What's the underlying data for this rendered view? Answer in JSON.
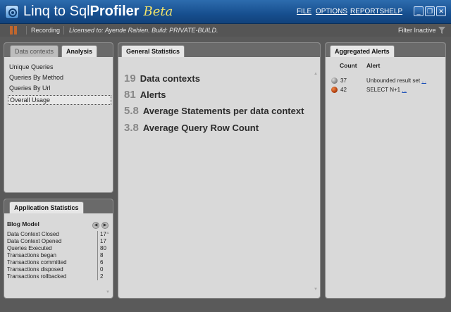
{
  "window": {
    "title_part1": "Linq to Sql",
    "title_part2": "Profiler",
    "title_part3": "Beta",
    "menu": [
      "FILE",
      "OPTIONS",
      "REPORTS",
      "HELP"
    ],
    "controls": [
      "_",
      "❐",
      "✕"
    ]
  },
  "toolbar": {
    "recording_label": "Recording",
    "license_text": "Licensed to: Ayende Rahien.  Build: PRIVATE-BUILD.",
    "filter_label": "Filter Inactive"
  },
  "left_panel": {
    "tabs": [
      "Data contexts",
      "Analysis"
    ],
    "items": [
      "Unique Queries",
      "Queries By Method",
      "Queries By Url",
      "Overall Usage"
    ]
  },
  "general_statistics": {
    "tab": "General Statistics",
    "stats": [
      {
        "value": "19",
        "label": "Data contexts"
      },
      {
        "value": "81",
        "label": "Alerts"
      },
      {
        "value": "5.8",
        "label": "Average Statements per data context"
      },
      {
        "value": "3.8",
        "label": "Average Query Row Count"
      }
    ]
  },
  "aggregated_alerts": {
    "tab": "Aggregated Alerts",
    "col_count": "Count",
    "col_alert": "Alert",
    "rows": [
      {
        "count": "37",
        "alert": "Unbounded result set",
        "link": "...",
        "color": "#8a8a8a"
      },
      {
        "count": "42",
        "alert": "SELECT N+1",
        "link": "...",
        "color": "#b3400f"
      }
    ]
  },
  "application_statistics": {
    "tab": "Application Statistics",
    "model": "Blog Model",
    "rows": [
      {
        "label": "Data Context Closed",
        "value": "17"
      },
      {
        "label": "Data Context Opened",
        "value": "17"
      },
      {
        "label": "Queries Executed",
        "value": "80"
      },
      {
        "label": "Transactions began",
        "value": "8"
      },
      {
        "label": "Transactions committed",
        "value": "6"
      },
      {
        "label": "Transactions disposed",
        "value": "0"
      },
      {
        "label": "Transactions rollbacked",
        "value": "2"
      }
    ]
  }
}
